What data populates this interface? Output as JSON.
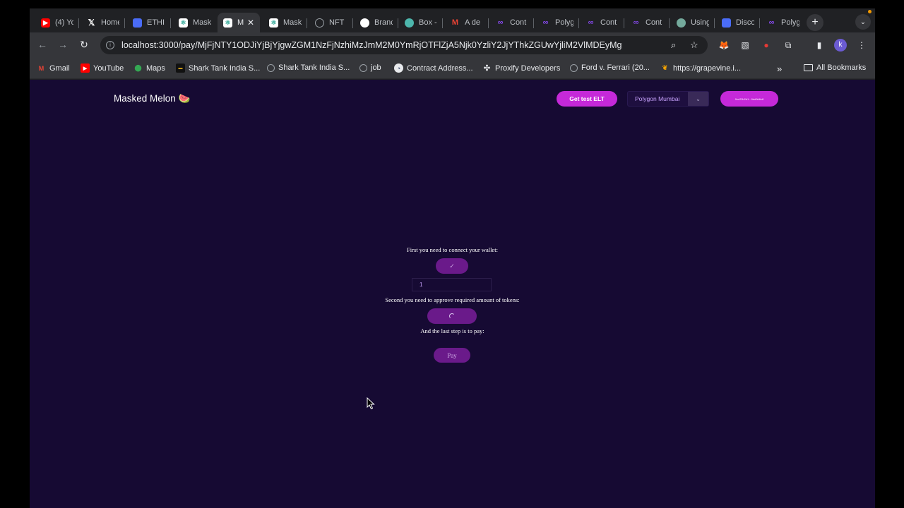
{
  "browser": {
    "tabs": [
      {
        "label": "(4) Yo",
        "icon": "youtube-icon",
        "color": "#ff0000"
      },
      {
        "label": "Home",
        "icon": "x-icon",
        "color": "#000000"
      },
      {
        "label": "ETHI",
        "icon": "docs-icon",
        "color": "#4a6cf7"
      },
      {
        "label": "Mask",
        "icon": "react-icon",
        "color": "#ffffff"
      },
      {
        "label": "M",
        "icon": "react-icon",
        "color": "#ffffff"
      },
      {
        "label": "Mask",
        "icon": "react-icon",
        "color": "#ffffff"
      },
      {
        "label": "NFT",
        "icon": "globe-icon",
        "color": "#9aa0a6"
      },
      {
        "label": "Branc",
        "icon": "github-icon",
        "color": "#ffffff"
      },
      {
        "label": "Box -",
        "icon": "box-icon",
        "color": "#4db6ac"
      },
      {
        "label": "A de",
        "icon": "gmail-icon",
        "color": "#ea4335"
      },
      {
        "label": "Cont",
        "icon": "polygon-icon",
        "color": "#8247e5"
      },
      {
        "label": "Polyg",
        "icon": "polygon-icon",
        "color": "#8247e5"
      },
      {
        "label": "Cont",
        "icon": "polygon-icon",
        "color": "#8247e5"
      },
      {
        "label": "Cont",
        "icon": "polygon-icon",
        "color": "#8247e5"
      },
      {
        "label": "Using",
        "icon": "openai-icon",
        "color": "#74aa9c"
      },
      {
        "label": "Disco",
        "icon": "docs-icon",
        "color": "#4a6cf7"
      },
      {
        "label": "Polyg",
        "icon": "polygon-icon",
        "color": "#8247e5"
      }
    ],
    "active_tab_index": 4,
    "url": "localhost:3000/pay/MjFjNTY1ODJiYjBjYjgwZGM1NzFjNzhiMzJmM2M0YmRjOTFlZjA5Njk0YzliY2JjYThkZGUwYjliM2VlMDEyMg",
    "bookmarks": [
      {
        "label": "Gmail",
        "icon": "gmail-icon"
      },
      {
        "label": "YouTube",
        "icon": "youtube-icon"
      },
      {
        "label": "Maps",
        "icon": "maps-icon"
      },
      {
        "label": "Shark Tank India S...",
        "icon": "sonyliv-icon"
      },
      {
        "label": "Shark Tank India S...",
        "icon": "globe-icon"
      },
      {
        "label": "job",
        "icon": "globe-icon"
      },
      {
        "label": "Contract Address...",
        "icon": "etherscan-icon"
      },
      {
        "label": "Proxify Developers",
        "icon": "proxify-icon"
      },
      {
        "label": "Ford v. Ferrari (20...",
        "icon": "globe-icon"
      },
      {
        "label": "https://grapevine.i...",
        "icon": "grapevine-icon"
      }
    ],
    "all_bookmarks_label": "All Bookmarks"
  },
  "app": {
    "logo_text": "Masked Melon 🍉",
    "get_test_button": "Get test ELT",
    "network_select": "Polygon Mumbai",
    "wallet_address": "0xc22b2d1...9dd9d6c8",
    "step1_text": "First you need to connect your wallet:",
    "connect_check": "✓",
    "amount_value": "1",
    "step2_text": "Second you need to approve required amount of tokens:",
    "step3_text": "And the last step is to pay:",
    "pay_button": "Pay",
    "accent_color": "#c529d9",
    "background_color": "#160a33"
  }
}
